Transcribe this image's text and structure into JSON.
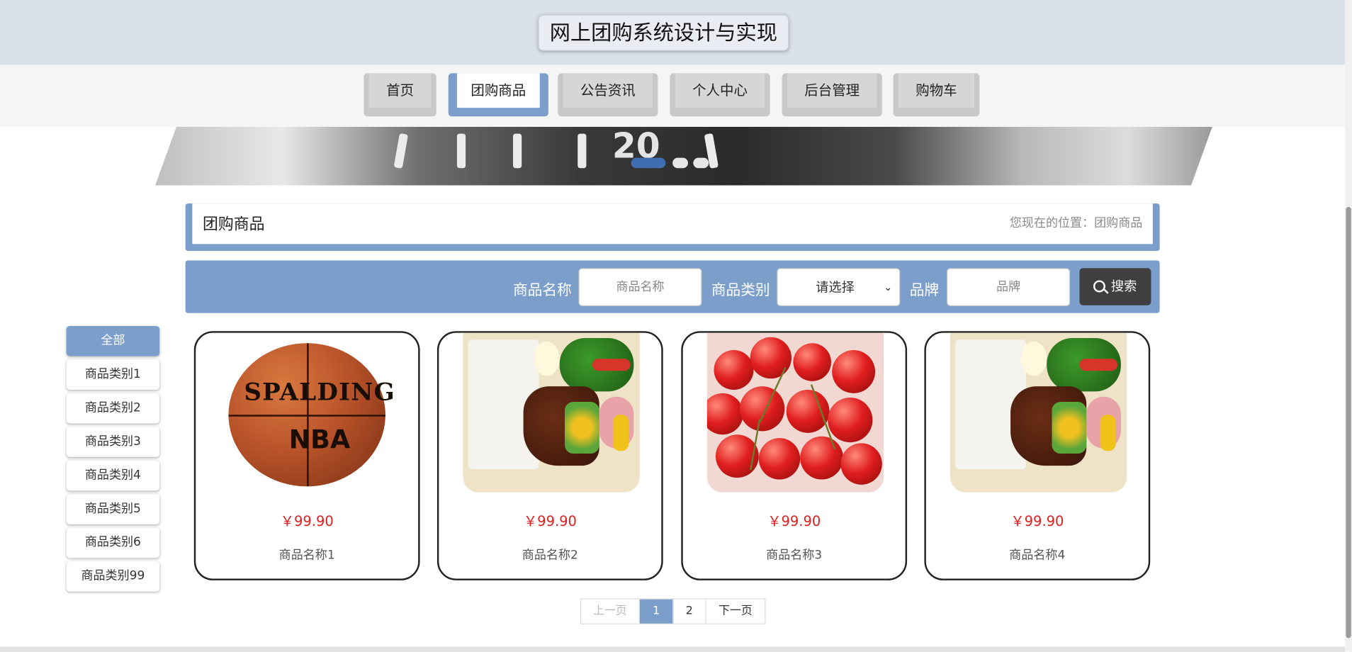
{
  "site": {
    "title": "网上团购系统设计与实现"
  },
  "nav": {
    "items": [
      {
        "label": "首页"
      },
      {
        "label": "团购商品"
      },
      {
        "label": "公告资讯"
      },
      {
        "label": "个人中心"
      },
      {
        "label": "后台管理"
      },
      {
        "label": "购物车"
      }
    ],
    "active_index": 1
  },
  "banner": {
    "number_text": "20",
    "slides": 3,
    "active_slide": 0
  },
  "section": {
    "title": "团购商品",
    "breadcrumb": "您现在的位置：团购商品"
  },
  "search": {
    "name_label": "商品名称",
    "name_placeholder": "商品名称",
    "category_label": "商品类别",
    "category_value": "请选择",
    "brand_label": "品牌",
    "brand_placeholder": "品牌",
    "button_label": "搜索"
  },
  "categories": [
    {
      "label": "全部"
    },
    {
      "label": "商品类别1"
    },
    {
      "label": "商品类别2"
    },
    {
      "label": "商品类别3"
    },
    {
      "label": "商品类别4"
    },
    {
      "label": "商品类别5"
    },
    {
      "label": "商品类别6"
    },
    {
      "label": "商品类别99"
    }
  ],
  "products": [
    {
      "price": "￥99.90",
      "name": "商品名称1",
      "image": "basketball",
      "brand_text": "SPALDING",
      "logo_text": "NBA"
    },
    {
      "price": "￥99.90",
      "name": "商品名称2",
      "image": "bento"
    },
    {
      "price": "￥99.90",
      "name": "商品名称3",
      "image": "cherries"
    },
    {
      "price": "￥99.90",
      "name": "商品名称4",
      "image": "bento"
    }
  ],
  "pagination": {
    "prev": "上一页",
    "pages": [
      "1",
      "2"
    ],
    "current": "1",
    "next": "下一页"
  },
  "colors": {
    "accent": "#7b9fca",
    "price": "#e02020",
    "header_bg": "#d9e0ea",
    "search_button": "#3f3f3f"
  }
}
